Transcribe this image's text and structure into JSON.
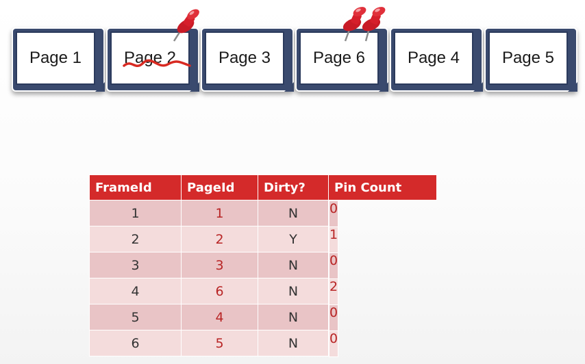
{
  "frames": [
    {
      "label": "Page 1"
    },
    {
      "label": "Page 2"
    },
    {
      "label": "Page 3"
    },
    {
      "label": "Page 6"
    },
    {
      "label": "Page 4"
    },
    {
      "label": "Page 5"
    }
  ],
  "table": {
    "headers": [
      "FrameId",
      "PageId",
      "Dirty?",
      "Pin Count"
    ],
    "rows": [
      [
        "1",
        "1",
        "N",
        "0"
      ],
      [
        "2",
        "2",
        "Y",
        "1"
      ],
      [
        "3",
        "3",
        "N",
        "0"
      ],
      [
        "4",
        "6",
        "N",
        "2"
      ],
      [
        "5",
        "4",
        "N",
        "0"
      ],
      [
        "6",
        "5",
        "N",
        "0"
      ]
    ]
  },
  "colors": {
    "header_red": "#d42a2a",
    "pin_red": "#d61f2b",
    "frame_navy": "#3a4a6e"
  },
  "icons": [
    "pushpin-icon",
    "strike-through-mark"
  ]
}
